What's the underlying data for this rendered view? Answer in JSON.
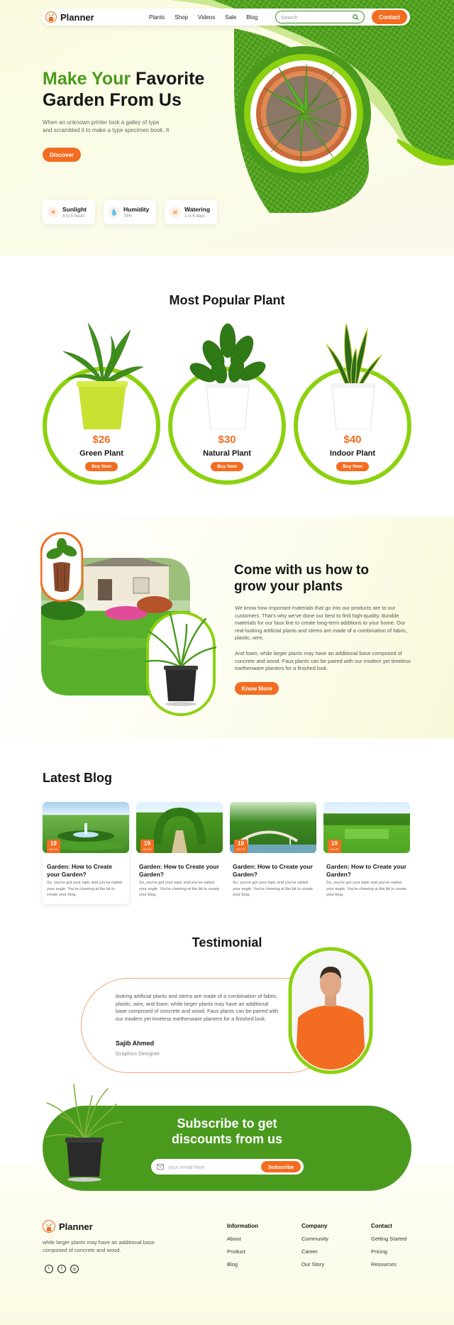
{
  "brand": {
    "name": "Planner"
  },
  "nav": {
    "links": [
      "Plants",
      "Shop",
      "Videos",
      "Sale",
      "Blog"
    ],
    "search_placeholder": "Search",
    "contact_label": "Contact"
  },
  "hero": {
    "title_green": "Make Your",
    "title_rest_line1": "Favorite",
    "title_line2": "Garden From Us",
    "subtitle_line1": "When an unknown printer took a galley of type",
    "subtitle_line2": "and scrambled it to make a type specimen book. It",
    "cta_label": "Discover",
    "stats": [
      {
        "icon": "sun-icon",
        "title": "Sunlight",
        "sub": "4 to 5 hours"
      },
      {
        "icon": "drop-icon",
        "title": "Humidity",
        "sub": "78%"
      },
      {
        "icon": "watering-icon",
        "title": "Watering",
        "sub": "1 in 6 days"
      }
    ]
  },
  "popular": {
    "title": "Most Popular Plant",
    "items": [
      {
        "price": "$26",
        "name": "Green Plant",
        "button": "Buy Now",
        "pot_color": "#c9e232"
      },
      {
        "price": "$30",
        "name": "Natural Plant",
        "button": "Buy Now",
        "pot_color": "#ffffff"
      },
      {
        "price": "$40",
        "name": "Indoor Plant",
        "button": "Buy Now",
        "pot_color": "#ffffff"
      }
    ]
  },
  "grow": {
    "title_line1": "Come with us how to",
    "title_line2": "grow your plants",
    "para1": "We know how important materials that go into our products are to our customers. That's why we've done our best to find high-quality, durable materials for our faux line to create long-term additions to your home. Our real-looking artificial plants and stems are made of a combination of fabric, plastic, wire,",
    "para2": "And foam, while larger plants may have an additional base composed of concrete and wood. Faux plants can be paired with our modern yet timeless earthenware planters for a finished look.",
    "cta_label": "Know More"
  },
  "blog": {
    "title": "Latest Blog",
    "posts": [
      {
        "day": "19",
        "month": "Dec'21",
        "title": "Garden: How to Create your Garden?",
        "excerpt": "So, you've got your topic and you've nailed your angle. You're chewing at the bit to create your blog."
      },
      {
        "day": "19",
        "month": "Dec'21",
        "title": "Garden: How to Create your Garden?",
        "excerpt": "So, you've got your topic and you've nailed your angle. You're chewing at the bit to create your blog."
      },
      {
        "day": "19",
        "month": "Dec'21",
        "title": "Garden: How to Create your Garden?",
        "excerpt": "So, you've got your topic and you've nailed your angle. You're chewing at the bit to create your blog."
      },
      {
        "day": "19",
        "month": "Dec'21",
        "title": "Garden: How to Create your Garden?",
        "excerpt": "So, you've got your topic and you've nailed your angle. You're chewing at the bit to create your blog."
      }
    ]
  },
  "testimonial": {
    "title": "Testimonial",
    "quote": "looking artificial plants and stems are made of a combination of fabric, plastic, wire, and foam, while larger plants may have an additional base composed of concrete and wood. Faux plants can be paired with our modern yet timeless earthenware planters for a finished look.",
    "name": "Sajib Ahmed",
    "role": "Graphics Designer"
  },
  "subscribe": {
    "title_line1": "Subscribe to get",
    "title_line2": "discounts from us",
    "placeholder": "your email here",
    "button": "Subscribe"
  },
  "footer": {
    "tagline": "while larger plants may have an additional base composed of concrete and wood.",
    "social": [
      "twitter-icon",
      "facebook-icon",
      "instagram-icon"
    ],
    "columns": [
      {
        "heading": "Information",
        "links": [
          "About",
          "Product",
          "Blog"
        ]
      },
      {
        "heading": "Company",
        "links": [
          "Community",
          "Career",
          "Our Story"
        ]
      },
      {
        "heading": "Contact",
        "links": [
          "Getting Started",
          "Pricing",
          "Resources"
        ]
      }
    ]
  },
  "colors": {
    "accent": "#f26d21",
    "brand_green": "#4a9a1e",
    "lime": "#8cd10f"
  }
}
